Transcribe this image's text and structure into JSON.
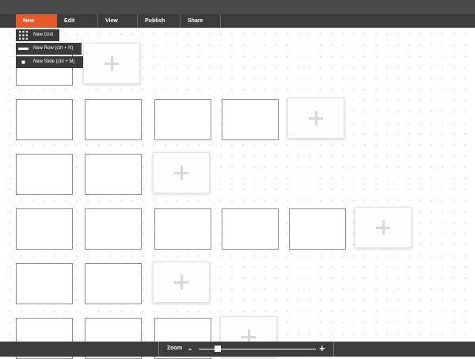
{
  "menubar": {
    "items": [
      {
        "label": "New",
        "active": true
      },
      {
        "label": "Edit"
      },
      {
        "label": "View"
      },
      {
        "label": "Publish"
      },
      {
        "label": "Share"
      }
    ]
  },
  "new_menu": {
    "items": [
      {
        "label": "New Grid",
        "icon": "grid-icon"
      },
      {
        "label": "New Row (ctrl + N)",
        "icon": "row-icon"
      },
      {
        "label": "New Slide (ctrl + M)",
        "icon": "slide-icon"
      }
    ]
  },
  "grid": {
    "rows": [
      {
        "slides": 1,
        "add_button": true
      },
      {
        "slides": 4,
        "add_button": true
      },
      {
        "slides": 2,
        "add_button": true
      },
      {
        "slides": 5,
        "add_button": true
      },
      {
        "slides": 2,
        "add_button": true
      },
      {
        "slides": 3,
        "add_button": true
      }
    ]
  },
  "bottombar": {
    "zoom_label": "Zoom",
    "zoom_minus": "-",
    "zoom_plus": "+",
    "zoom_level": 0.16
  },
  "colors": {
    "accent": "#e8592a",
    "bar": "#3c3c3c",
    "dropdown": "#3a3a3a"
  }
}
